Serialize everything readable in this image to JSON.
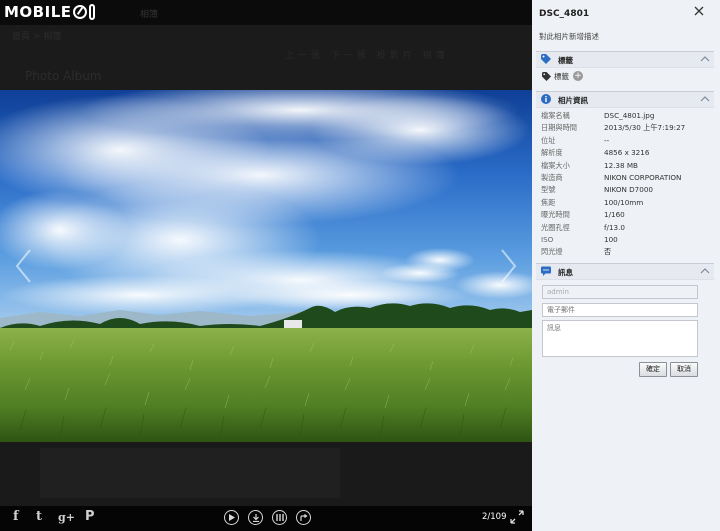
{
  "brand": {
    "logo_text": "MOBILE"
  },
  "topnav": {
    "text": "相簿"
  },
  "background_strip": {
    "breadcrumb": "首頁 > 相簿",
    "links": "上一張 下一張 投影片 相簿",
    "album_title": "Photo Album"
  },
  "viewer": {
    "counter": "2/109",
    "social_icons": [
      "facebook-icon",
      "twitter-icon",
      "googleplus-icon",
      "plurk-icon"
    ],
    "controls": [
      "play-icon",
      "download-icon",
      "thumbnails-icon",
      "share-icon"
    ]
  },
  "panel": {
    "title": "DSC_4801",
    "description_placeholder": "對此相片新增描述",
    "tags": {
      "header": "標籤",
      "tag_label": "標籤",
      "add_symbol": "+"
    },
    "info": {
      "header": "相片資訊",
      "rows": [
        {
          "k": "檔案名稱",
          "v": "DSC_4801.jpg"
        },
        {
          "k": "日期與時間",
          "v": "2013/5/30 上午7:19:27"
        },
        {
          "k": "位址",
          "v": "--"
        },
        {
          "k": "解析度",
          "v": "4856 x 3216"
        },
        {
          "k": "檔案大小",
          "v": "12.38 MB"
        },
        {
          "k": "製造商",
          "v": "NIKON CORPORATION"
        },
        {
          "k": "型號",
          "v": "NIKON D7000"
        },
        {
          "k": "焦距",
          "v": "100/10mm"
        },
        {
          "k": "曝光時間",
          "v": "1/160"
        },
        {
          "k": "光圈孔徑",
          "v": "f/13.0"
        },
        {
          "k": "ISO",
          "v": "100"
        },
        {
          "k": "閃光燈",
          "v": "否"
        }
      ]
    },
    "message": {
      "header": "訊息",
      "name_value": "admin",
      "email_placeholder": "電子郵件",
      "message_placeholder": "訊息",
      "confirm_label": "確定",
      "cancel_label": "取消"
    }
  },
  "colors": {
    "panel_bg": "#eef1f5",
    "accent_blue": "#2b6cc4",
    "viewer_bg": "#161616",
    "toolbar_bg": "#050505"
  }
}
